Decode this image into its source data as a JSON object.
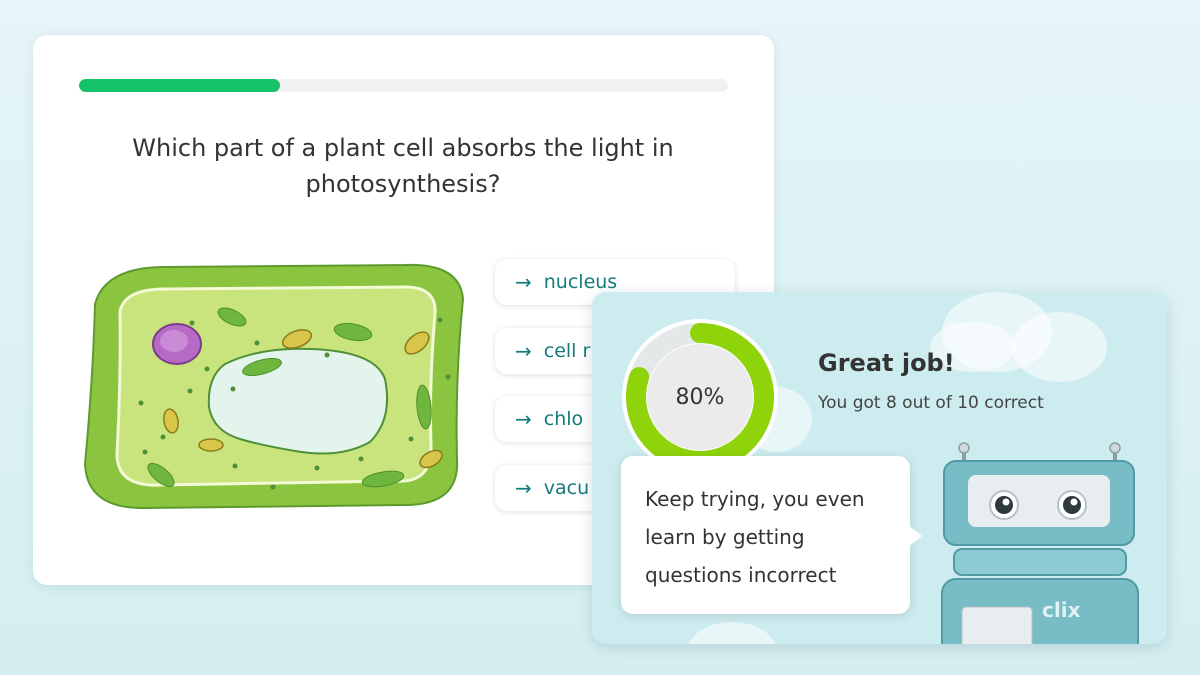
{
  "quiz": {
    "progress": 0.31,
    "question": "Which part of a plant cell absorbs the light in photosynthesis?",
    "answers": [
      {
        "label": "nucleus"
      },
      {
        "label": "cell r"
      },
      {
        "label": "chlo"
      },
      {
        "label": "vacu"
      }
    ]
  },
  "result": {
    "percent_value": 0.8,
    "percent_label": "80%",
    "title": "Great job!",
    "score_text": "You got 8 out of 10 correct",
    "message": "Keep trying, you even learn by getting questions incorrect",
    "robot_label": "clix"
  },
  "colors": {
    "progress_green": "#15c269",
    "ring_green": "#8fd30a",
    "answer_text": "#157a7c",
    "result_bg": "#cdecef"
  },
  "icons": [
    "arrow-right-icon",
    "plant-cell-illustration",
    "robot-mascot"
  ]
}
